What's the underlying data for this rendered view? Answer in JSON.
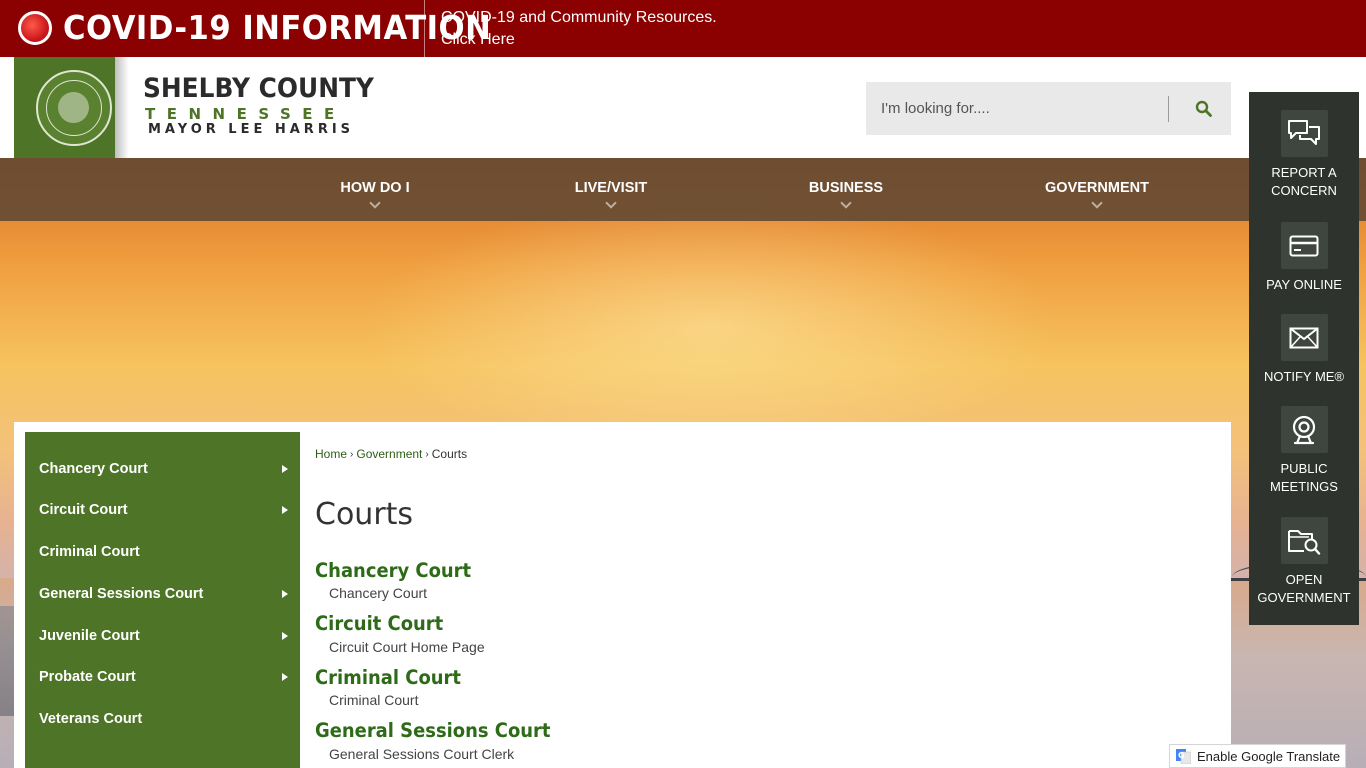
{
  "covid_banner": {
    "title": "COVID-19 INFORMATION",
    "resources_line1": "COVID-19 and Community Resources.",
    "resources_line2": "Click Here"
  },
  "header": {
    "county_name": "SHELBY COUNTY",
    "state_name": "TENNESSEE",
    "mayor_name": "MAYOR LEE HARRIS",
    "search_placeholder": "I'm looking for....",
    "search_icon": "search-icon"
  },
  "nav": {
    "items": [
      {
        "label": "HOW DO I"
      },
      {
        "label": "LIVE/VISIT"
      },
      {
        "label": "BUSINESS"
      },
      {
        "label": "GOVERNMENT"
      }
    ]
  },
  "sidebar": {
    "items": [
      {
        "label": "Chancery Court",
        "has_submenu": true
      },
      {
        "label": "Circuit Court",
        "has_submenu": true
      },
      {
        "label": "Criminal Court",
        "has_submenu": false
      },
      {
        "label": "General Sessions Court",
        "has_submenu": true
      },
      {
        "label": "Juvenile Court",
        "has_submenu": true
      },
      {
        "label": "Probate Court",
        "has_submenu": true
      },
      {
        "label": "Veterans Court",
        "has_submenu": false
      }
    ]
  },
  "breadcrumb": {
    "home": "Home",
    "government": "Government",
    "current": "Courts"
  },
  "page": {
    "title": "Courts",
    "courts": [
      {
        "title": "Chancery Court",
        "description": "Chancery Court"
      },
      {
        "title": "Circuit Court",
        "description": "Circuit Court Home Page"
      },
      {
        "title": "Criminal Court",
        "description": "Criminal Court"
      },
      {
        "title": "General Sessions Court",
        "description": "General Sessions Court Clerk"
      }
    ]
  },
  "quick_links": {
    "items": [
      {
        "label_line1": "REPORT A",
        "label_line2": "CONCERN",
        "icon": "chat-bubbles-icon"
      },
      {
        "label_line1": "PAY ONLINE",
        "label_line2": "",
        "icon": "credit-card-icon"
      },
      {
        "label_line1": "NOTIFY ME®",
        "label_line2": "",
        "icon": "envelope-icon"
      },
      {
        "label_line1": "PUBLIC",
        "label_line2": "MEETINGS",
        "icon": "webcam-icon"
      },
      {
        "label_line1": "OPEN",
        "label_line2": "GOVERNMENT",
        "icon": "folder-search-icon"
      }
    ]
  },
  "translate": {
    "label": "Enable Google Translate"
  },
  "colors": {
    "covid_red": "#8b0000",
    "brand_green": "#4e7428",
    "link_green": "#2e6b18",
    "nav_brown": "#604832",
    "quick_panel": "#2e332e"
  }
}
